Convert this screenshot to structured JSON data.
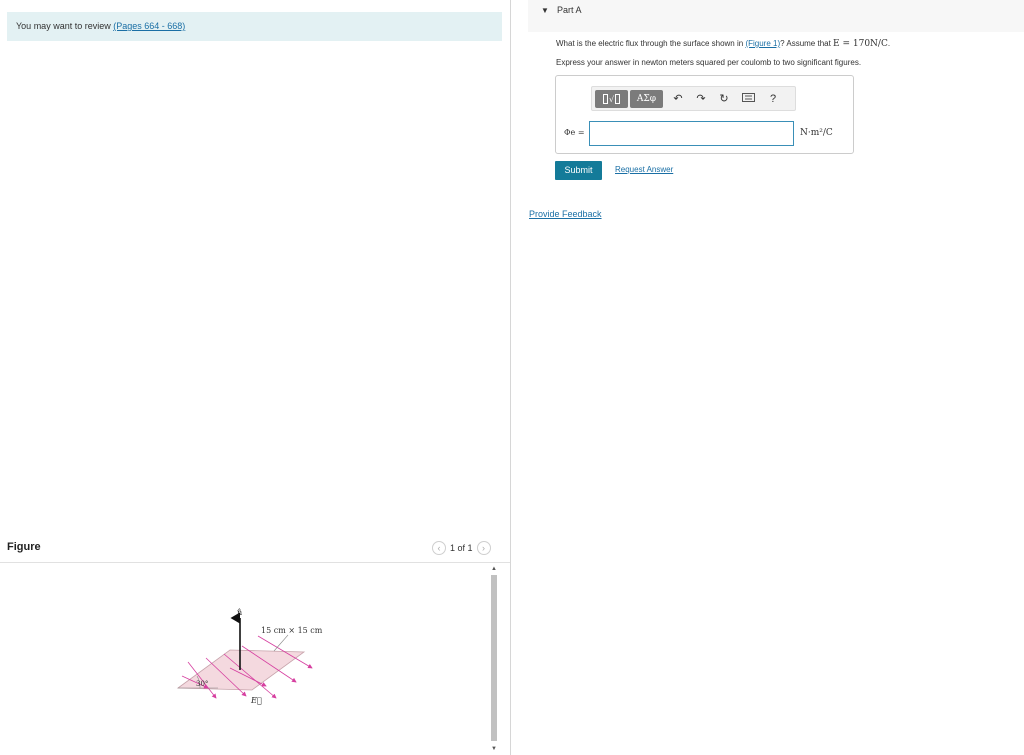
{
  "review": {
    "prefix": "You may want to review ",
    "link": "(Pages 664 - 668)"
  },
  "figure_panel": {
    "title": "Figure",
    "pager": "1 of 1",
    "prev_icon": "chevron-left-icon",
    "next_icon": "chevron-right-icon",
    "diagram": {
      "normal_label": "n̂",
      "size_label": "15 cm × 15 cm",
      "angle_label": "30°",
      "field_label": "E⃗"
    }
  },
  "part": {
    "label": "Part A",
    "question_prefix": "What is the electric flux through the surface shown in ",
    "question_link": "(Figure 1)",
    "question_mid": "? Assume that ",
    "question_math": "E = 170N/C",
    "question_suffix": ".",
    "instruction": "Express your answer in newton meters squared per coulomb to two significant figures.",
    "toolbar": {
      "templates_label": "√",
      "symbols_label": "ΑΣφ",
      "undo_icon": "undo-icon",
      "redo_icon": "redo-icon",
      "reset_icon": "reset-icon",
      "keyboard_icon": "keyboard-icon",
      "help_label": "?"
    },
    "answer_label": "Φe =",
    "answer_value": "",
    "units": "N·m²/C",
    "submit_label": "Submit",
    "request_label": "Request Answer"
  },
  "feedback_label": "Provide Feedback",
  "colors": {
    "accent": "#147b99",
    "link": "#1a6fa5",
    "review_bg": "#e3f1f3",
    "field_arrows": "#d63fa0"
  }
}
